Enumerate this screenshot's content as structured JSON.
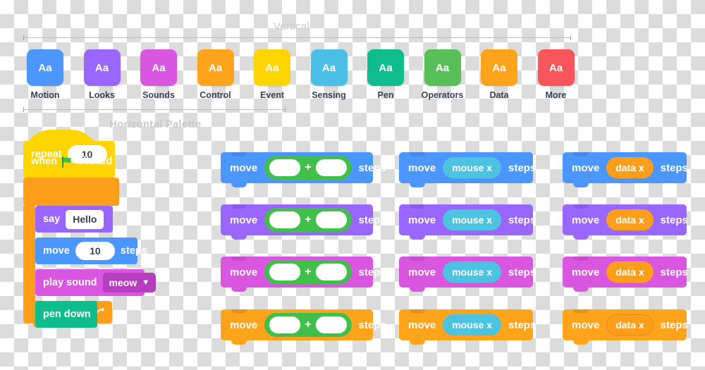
{
  "annotations": {
    "vertical_label": "Vertical",
    "horizontal_label": "Horizontal Palette"
  },
  "palette": {
    "sample_text": "Aa",
    "categories": [
      {
        "label": "Motion",
        "color": "#4c97ff"
      },
      {
        "label": "Looks",
        "color": "#9966ff"
      },
      {
        "label": "Sounds",
        "color": "#d957e0"
      },
      {
        "label": "Control",
        "color": "#ffa41b"
      },
      {
        "label": "Event",
        "color": "#ffd500"
      },
      {
        "label": "Sensing",
        "color": "#4cbfe6"
      },
      {
        "label": "Pen",
        "color": "#0fbd8c"
      },
      {
        "label": "Operators",
        "color": "#59c059"
      },
      {
        "label": "Data",
        "color": "#ffa41b"
      },
      {
        "label": "More",
        "color": "#f8565a"
      }
    ]
  },
  "script": {
    "hat": {
      "when": "when",
      "flag_icon": "green-flag-icon",
      "clicked": "clicked"
    },
    "repeat": {
      "label": "repeat",
      "value": "10",
      "loop_icon": "loop-arrow-icon",
      "color": "#ff9e1b"
    },
    "inner": [
      {
        "name": "say-block",
        "label": "say",
        "value": "Hello",
        "value_kind": "text",
        "color": "#9966ff"
      },
      {
        "name": "move-block",
        "label": "move",
        "value": "10",
        "suffix": "steps",
        "value_kind": "number",
        "color": "#4c97ff"
      },
      {
        "name": "play-sound-block",
        "label": "play sound",
        "value": "meow",
        "value_kind": "dropdown",
        "color": "#d957e0",
        "dropdown_color": "#b83ec0",
        "chevron": "▼"
      },
      {
        "name": "pen-down-block",
        "label": "pen down",
        "color": "#0fbd8c"
      }
    ]
  },
  "grid": {
    "prefix_label": "move",
    "suffix_label": "steps",
    "row_colors": [
      "#4c97ff",
      "#9966ff",
      "#d957e0",
      "#ffa41b"
    ],
    "columns": [
      {
        "kind": "operator",
        "name": "addition-operator",
        "color": "#40bf4a",
        "sign": "+",
        "slot_left": "",
        "slot_right": ""
      },
      {
        "kind": "reporter",
        "name": "mouse-x-reporter",
        "color": "#4cc3e0",
        "text": "mouse x"
      },
      {
        "kind": "reporter",
        "name": "data-x-reporter",
        "color": "#ff9e1b",
        "text": "data x"
      }
    ]
  }
}
